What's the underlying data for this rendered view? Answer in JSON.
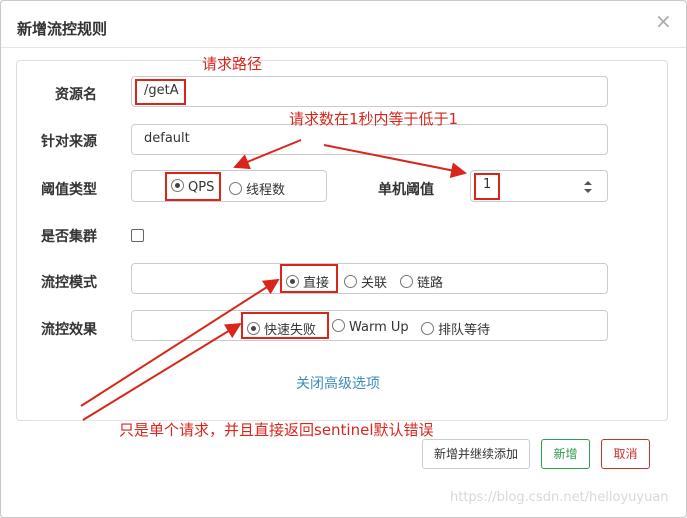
{
  "dialog": {
    "title": "新增流控规则",
    "close_symbol": "×"
  },
  "form": {
    "resource_name": {
      "label": "资源名",
      "value": "/getA"
    },
    "limit_app": {
      "label": "针对来源",
      "value": "default"
    },
    "threshold_type": {
      "label": "阈值类型",
      "options": [
        "QPS",
        "线程数"
      ],
      "selected": "QPS"
    },
    "single_threshold": {
      "label": "单机阈值",
      "value": "1"
    },
    "cluster_mode": {
      "label": "是否集群",
      "checked": false
    },
    "control_mode": {
      "label": "流控模式",
      "options": [
        "直接",
        "关联",
        "链路"
      ],
      "selected": "直接"
    },
    "control_effect": {
      "label": "流控效果",
      "options": [
        "快速失败",
        "Warm Up",
        "排队等待"
      ],
      "selected": "快速失败"
    },
    "advanced_toggle": "关闭高级选项"
  },
  "buttons": {
    "add_continue": "新增并继续添加",
    "add": "新增",
    "cancel": "取消"
  },
  "annotations": {
    "path_note": "请求路径",
    "threshold_note": "请求数在1秒内等于低于1",
    "behavior_note": "只是单个请求，并且直接返回sentinel默认错误",
    "color": "#d9261c"
  },
  "watermark": "https://blog.csdn.net/helloyuyuan",
  "colors": {
    "add_button": "#2e9e4a",
    "cancel_button": "#c9302c",
    "link": "#3c8dbc"
  }
}
